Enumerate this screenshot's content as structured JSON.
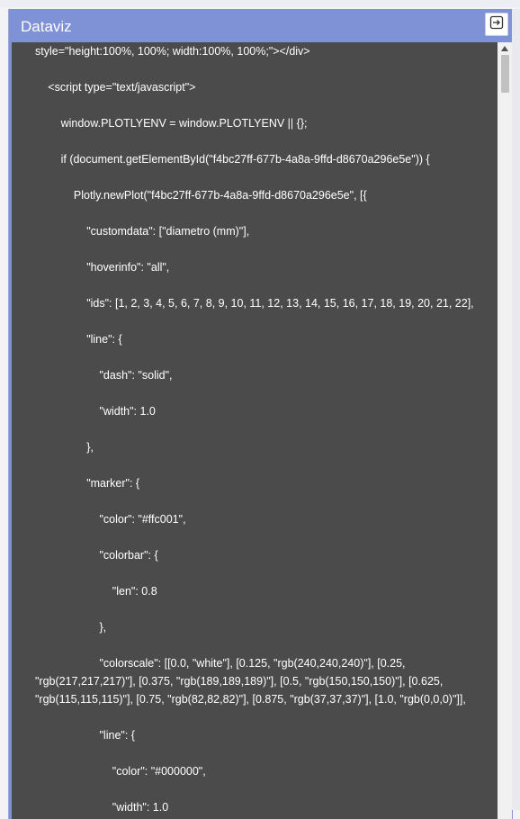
{
  "panel": {
    "title": "Dataviz",
    "exit_icon": "exit-panel-icon"
  },
  "code_lines": [
    {
      "indent": 0,
      "text": "style=\"height:100%, 100%; width:100%, 100%;\"></div>"
    },
    {
      "indent": 1,
      "text": "<script type=\"text/javascript\">"
    },
    {
      "indent": 2,
      "text": "window.PLOTLYENV = window.PLOTLYENV || {};"
    },
    {
      "indent": 2,
      "text": "if (document.getElementById(\"f4bc27ff-677b-4a8a-9ffd-d8670a296e5e\")) {"
    },
    {
      "indent": 3,
      "text": "Plotly.newPlot(\"f4bc27ff-677b-4a8a-9ffd-d8670a296e5e\", [{"
    },
    {
      "indent": 4,
      "text": "\"customdata\": [\"diametro (mm)\"],"
    },
    {
      "indent": 4,
      "text": "\"hoverinfo\": \"all\","
    },
    {
      "indent": 4,
      "text": "\"ids\": [1, 2, 3, 4, 5, 6, 7, 8, 9, 10, 11, 12, 13, 14, 15, 16, 17, 18, 19, 20, 21, 22],"
    },
    {
      "indent": 4,
      "text": "\"line\": {"
    },
    {
      "indent": 5,
      "text": "\"dash\": \"solid\","
    },
    {
      "indent": 5,
      "text": "\"width\": 1.0"
    },
    {
      "indent": 4,
      "text": "},"
    },
    {
      "indent": 4,
      "text": "\"marker\": {"
    },
    {
      "indent": 5,
      "text": "\"color\": \"#ffc001\","
    },
    {
      "indent": 5,
      "text": "\"colorbar\": {"
    },
    {
      "indent": 6,
      "text": "\"len\": 0.8"
    },
    {
      "indent": 5,
      "text": "},"
    },
    {
      "indent": 5,
      "text": "\"colorscale\": [[0.0, \"white\"], [0.125, \"rgb(240,240,240)\"], [0.25, \"rgb(217,217,217)\"], [0.375, \"rgb(189,189,189)\"], [0.5, \"rgb(150,150,150)\"], [0.625, \"rgb(115,115,115)\"], [0.75, \"rgb(82,82,82)\"], [0.875, \"rgb(37,37,37)\"], [1.0, \"rgb(0,0,0)\"]],"
    },
    {
      "indent": 5,
      "text": "\"line\": {"
    },
    {
      "indent": 6,
      "text": "\"color\": \"#000000\","
    },
    {
      "indent": 6,
      "text": "\"width\": 1.0"
    }
  ]
}
